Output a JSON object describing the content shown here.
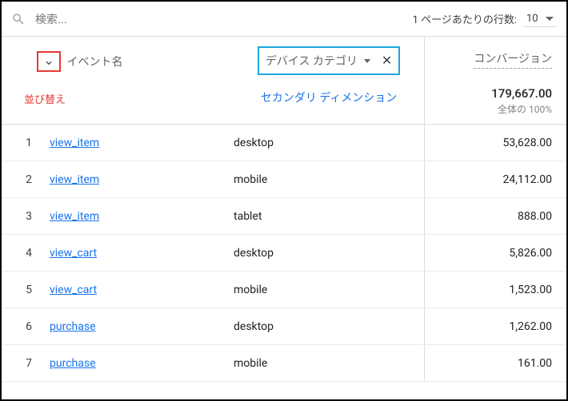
{
  "search": {
    "placeholder": "検索..."
  },
  "pagination": {
    "label": "1 ページあたりの行数:",
    "value": "10"
  },
  "headers": {
    "event": "イベント名",
    "sort_annotation": "並び替え",
    "device": "デバイス カテゴリ",
    "secondary_dim": "セカンダリ ディメンション",
    "conversion": "コンバージョン"
  },
  "totals": {
    "value": "179,667.00",
    "pct": "全体の 100%"
  },
  "rows": [
    {
      "idx": "1",
      "event": "view_item",
      "device": "desktop",
      "conv": "53,628.00"
    },
    {
      "idx": "2",
      "event": "view_item",
      "device": "mobile",
      "conv": "24,112.00"
    },
    {
      "idx": "3",
      "event": "view_item",
      "device": "tablet",
      "conv": "888.00"
    },
    {
      "idx": "4",
      "event": "view_cart",
      "device": "desktop",
      "conv": "5,826.00"
    },
    {
      "idx": "5",
      "event": "view_cart",
      "device": "mobile",
      "conv": "1,523.00"
    },
    {
      "idx": "6",
      "event": "purchase",
      "device": "desktop",
      "conv": "1,262.00"
    },
    {
      "idx": "7",
      "event": "purchase",
      "device": "mobile",
      "conv": "161.00"
    }
  ]
}
